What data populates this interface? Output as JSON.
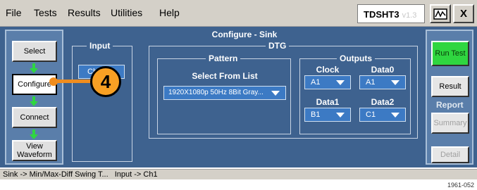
{
  "menu": [
    "File",
    "Tests",
    "Results",
    "Utilities",
    "Help"
  ],
  "app_title": "TDSHT3",
  "app_version": "v1.3",
  "close_label": "X",
  "nav": {
    "select": "Select",
    "configure": "Configure",
    "connect": "Connect",
    "view_waveform": "View Waveform"
  },
  "content": {
    "title": "Configure - Sink",
    "input": {
      "label": "Input",
      "button": "Ch1"
    },
    "dtg": {
      "label": "DTG",
      "pattern": {
        "label": "Pattern",
        "select_label": "Select From List",
        "value": "1920X1080p 50Hz 8Bit Gray..."
      },
      "outputs": {
        "label": "Outputs",
        "clock": {
          "label": "Clock",
          "value": "A1"
        },
        "data0": {
          "label": "Data0",
          "value": "A1"
        },
        "data1": {
          "label": "Data1",
          "value": "B1"
        },
        "data2": {
          "label": "Data2",
          "value": "C1"
        }
      }
    }
  },
  "right": {
    "run_test": "Run Test",
    "result": "Result",
    "report_label": "Report",
    "summary": "Summary",
    "detail": "Detail"
  },
  "callout_number": "4",
  "status": {
    "item1": "Sink -> Min/Max-Diff Swing T...",
    "item2": "Input -> Ch1"
  },
  "figure_code": "1961-052",
  "colors": {
    "panel_bg": "#3e628f",
    "run_button": "#2fd640",
    "dropdown": "#3c7ac4",
    "callout": "#f8a024"
  }
}
